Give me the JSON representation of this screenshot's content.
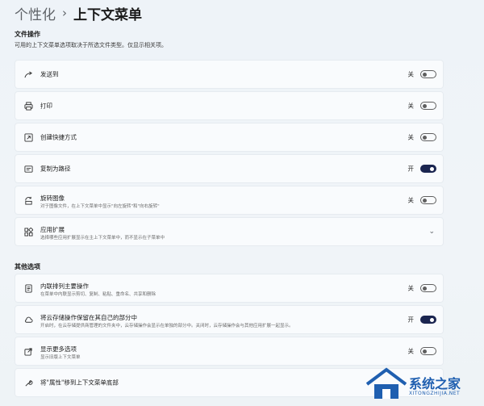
{
  "breadcrumb": {
    "parent": "个性化",
    "separator": "›",
    "current": "上下文菜单"
  },
  "file_ops": {
    "title": "文件操作",
    "description": "可用的上下文菜单选项取决于所选文件类型。仅显示相关项。"
  },
  "items": [
    {
      "label": "发送到",
      "state": "关",
      "on": false,
      "icon": "share-icon"
    },
    {
      "label": "打印",
      "state": "关",
      "on": false,
      "icon": "printer-icon"
    },
    {
      "label": "创建快捷方式",
      "state": "关",
      "on": false,
      "icon": "shortcut-icon"
    },
    {
      "label": "复制为路径",
      "state": "开",
      "on": true,
      "icon": "copy-path-icon"
    },
    {
      "label": "旋转图像",
      "sub": "对于图像文件，在上下文菜单中显示\"向左旋转\"和\"向右旋转\"",
      "state": "关",
      "on": false,
      "icon": "rotate-icon"
    },
    {
      "label": "应用扩展",
      "sub": "选择哪些应用扩展显示在主上下文菜单中，而不显示在子菜单中",
      "icon": "apps-icon",
      "expand": "⌄"
    }
  ],
  "other": {
    "title": "其他选项"
  },
  "other_items": [
    {
      "label": "内联排列主要操作",
      "sub": "在菜单中内联显示剪切、复制、粘贴、重命名、共享和删除",
      "state": "关",
      "on": false,
      "icon": "list-icon"
    },
    {
      "label": "将云存储操作保留在其自己的部分中",
      "sub": "开启时，在云存储提供商管理的文件夹中，云存储操作会显示在单独的部分中。关闭时，云存储操作会与其他应用扩展一起显示。",
      "state": "开",
      "on": true,
      "icon": "cloud-icon"
    },
    {
      "label": "显示更多选项",
      "sub": "显示旧版上下文菜单",
      "state": "关",
      "on": false,
      "icon": "more-options-icon"
    },
    {
      "label": "将\"属性\"移到上下文菜单底部",
      "icon": "wrench-icon"
    }
  ],
  "watermark": {
    "text": "系统之家",
    "sub": "XITONGZHIJIA.NET"
  }
}
